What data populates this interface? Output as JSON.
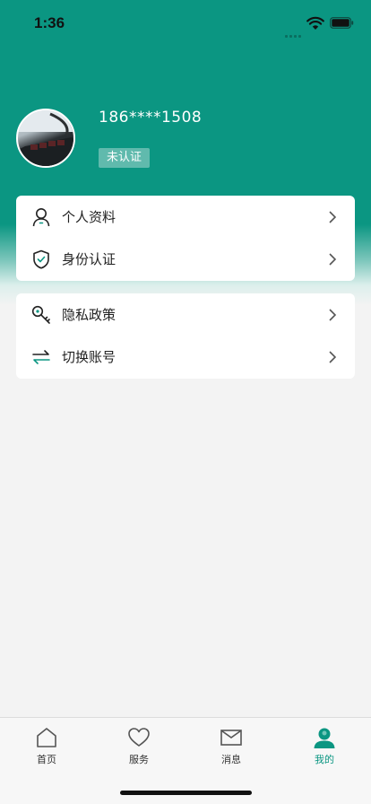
{
  "status_bar": {
    "time": "1:36"
  },
  "profile": {
    "phone": "186****1508",
    "cert_status": "未认证"
  },
  "menu_group_1": [
    {
      "label": "个人资料",
      "icon": "person-icon"
    },
    {
      "label": "身份认证",
      "icon": "shield-check-icon"
    }
  ],
  "menu_group_2": [
    {
      "label": "隐私政策",
      "icon": "key-icon"
    },
    {
      "label": "切换账号",
      "icon": "swap-arrows-icon"
    }
  ],
  "tabbar": {
    "tabs": [
      {
        "label": "首页",
        "icon": "home-icon"
      },
      {
        "label": "服务",
        "icon": "heart-icon"
      },
      {
        "label": "消息",
        "icon": "mail-icon"
      },
      {
        "label": "我的",
        "icon": "user-icon"
      }
    ],
    "active": "我的"
  },
  "colors": {
    "accent": "#0b9682",
    "background": "#f3f3f3",
    "card": "#ffffff"
  }
}
